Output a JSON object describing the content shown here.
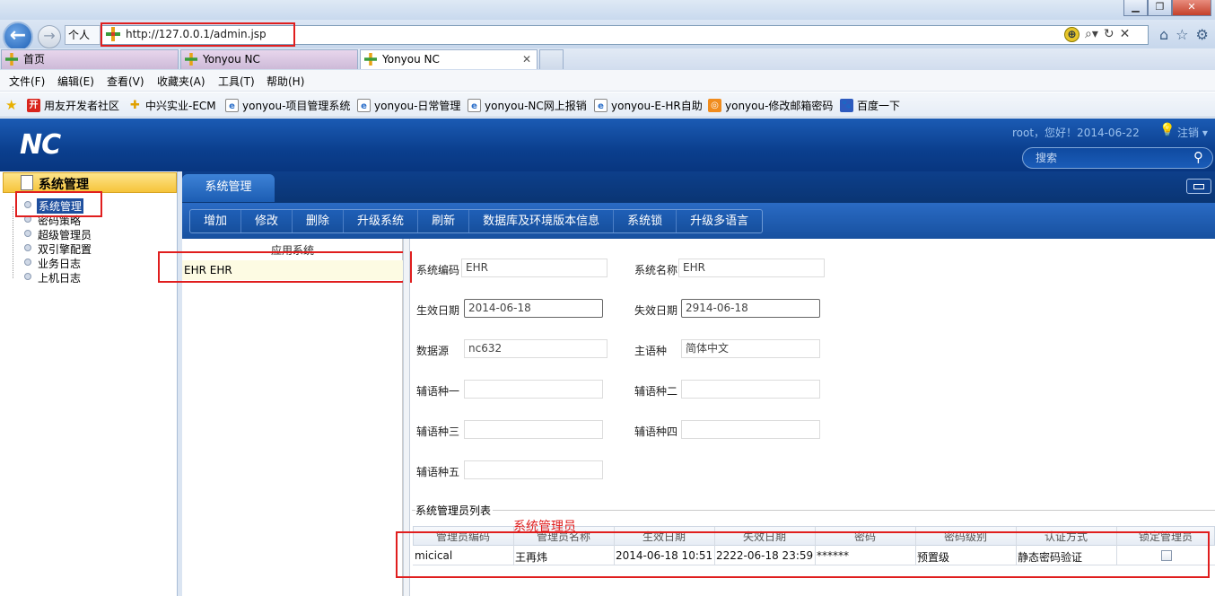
{
  "window": {
    "min_label": "▁",
    "max_label": "❐",
    "close_label": "✕"
  },
  "browser": {
    "back_glyph": "←",
    "forward_glyph": "→",
    "personal_label": "个人",
    "address": "http://127.0.0.1/admin.jsp",
    "addr_icons": [
      "⊕",
      "⌕▾",
      "↻",
      "✕"
    ],
    "tabs": [
      {
        "label": "首页",
        "active": false
      },
      {
        "label": "Yonyou NC",
        "active": false
      },
      {
        "label": "Yonyou NC",
        "active": true,
        "close": "✕"
      }
    ],
    "menu": [
      "文件(F)",
      "编辑(E)",
      "查看(V)",
      "收藏夹(A)",
      "工具(T)",
      "帮助(H)"
    ],
    "favorites": [
      {
        "label": "用友开发者社区",
        "icon": "开",
        "color": "#d9251d"
      },
      {
        "label": "中兴实业-ECM",
        "icon": "✚",
        "color": "#e0a000"
      },
      {
        "label": "yonyou-项目管理系统",
        "icon": "e",
        "color": "#2a6ec9"
      },
      {
        "label": "yonyou-日常管理",
        "icon": "e",
        "color": "#2a6ec9"
      },
      {
        "label": "yonyou-NC网上报销",
        "icon": "e",
        "color": "#2a6ec9"
      },
      {
        "label": "yonyou-E-HR自助",
        "icon": "e",
        "color": "#2a6ec9"
      },
      {
        "label": "yonyou-修改邮箱密码",
        "icon": "◎",
        "color": "#f08c1e"
      },
      {
        "label": "百度一下",
        "icon": "🐾",
        "color": "#2e5bbf"
      }
    ]
  },
  "nc": {
    "logo": "NC",
    "greeting": "root，您好！2014-06-22",
    "logout": "注销 ▾",
    "search_placeholder": "搜索"
  },
  "left": {
    "title": "系统管理",
    "items": [
      "系统管理",
      "密码策略",
      "超级管理员",
      "双引擎配置",
      "业务日志",
      "上机日志"
    ]
  },
  "content": {
    "tab": "系统管理",
    "toolbar": [
      "增加",
      "修改",
      "删除",
      "升级系统",
      "刷新",
      "数据库及环境版本信息",
      "系统锁",
      "升级多语言"
    ],
    "list_header": "应用系统",
    "list_row": "EHR   EHR"
  },
  "form": {
    "sys_code_label": "系统编码",
    "sys_code": "EHR",
    "sys_name_label": "系统名称",
    "sys_name": "EHR",
    "eff_date_label": "生效日期",
    "eff_date": "2014-06-18",
    "exp_date_label": "失效日期",
    "exp_date": "2914-06-18",
    "datasource_label": "数据源",
    "datasource": "nc632",
    "main_lang_label": "主语种",
    "main_lang": "简体中文",
    "lang1_label": "辅语种一",
    "lang1": "",
    "lang2_label": "辅语种二",
    "lang2": "",
    "lang3_label": "辅语种三",
    "lang3": "",
    "lang4_label": "辅语种四",
    "lang4": "",
    "lang5_label": "辅语种五",
    "lang5": ""
  },
  "grid": {
    "title": "系统管理员列表",
    "annotation": "系统管理员",
    "headers": [
      "管理员编码",
      "管理员名称",
      "生效日期",
      "失效日期",
      "密码",
      "密码级别",
      "认证方式",
      "锁定管理员"
    ],
    "row": [
      "micical",
      "王再炜",
      "2014-06-18 10:51:...",
      "2222-06-18 23:59:...",
      "******",
      "预置级",
      "静态密码验证"
    ]
  }
}
